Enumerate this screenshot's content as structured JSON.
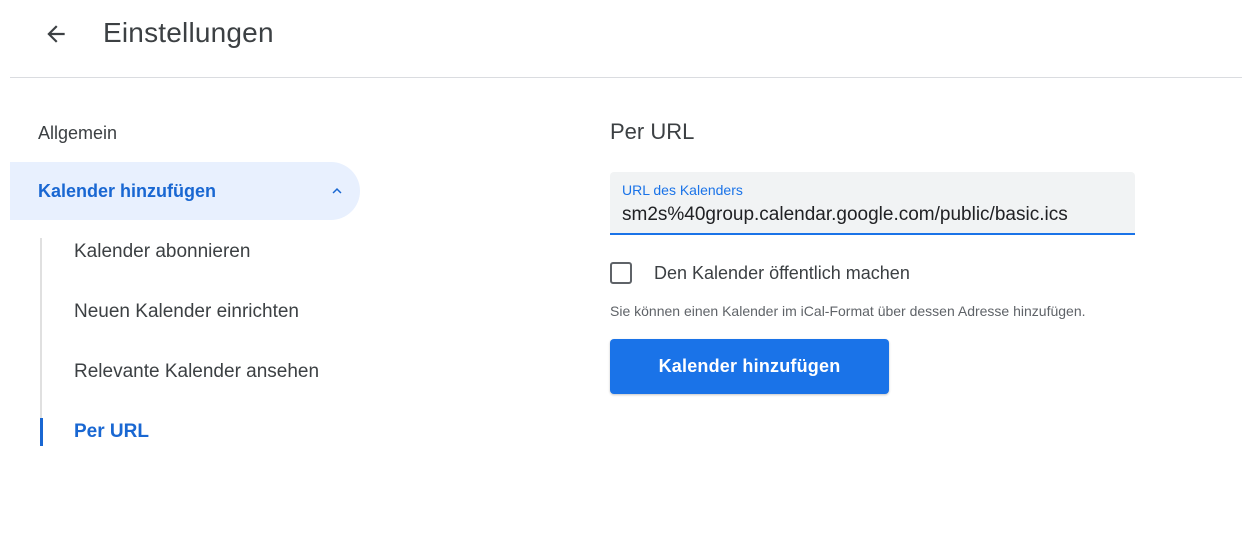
{
  "header": {
    "back_icon": "arrow-back-icon",
    "title": "Einstellungen"
  },
  "sidebar": {
    "general_label": "Allgemein",
    "section": {
      "label": "Kalender hinzufügen",
      "expanded": true,
      "chevron_icon": "chevron-up-icon"
    },
    "sub_items": [
      {
        "label": "Kalender abonnieren",
        "active": false
      },
      {
        "label": "Neuen Kalender einrichten",
        "active": false
      },
      {
        "label": "Relevante Kalender ansehen",
        "active": false
      },
      {
        "label": "Per URL",
        "active": true
      }
    ]
  },
  "main": {
    "title": "Per URL",
    "url_field": {
      "label": "URL des Kalenders",
      "value": "sm2s%40group.calendar.google.com/public/basic.ics"
    },
    "public_checkbox": {
      "label": "Den Kalender öffentlich machen",
      "checked": false
    },
    "hint": "Sie können einen Kalender im iCal-Format über dessen Adresse hinzufügen.",
    "add_button_label": "Kalender hinzufügen"
  },
  "colors": {
    "accent": "#1a73e8",
    "active_text": "#1967d2",
    "active_background": "#e8f0fe",
    "text": "#3c4043"
  }
}
